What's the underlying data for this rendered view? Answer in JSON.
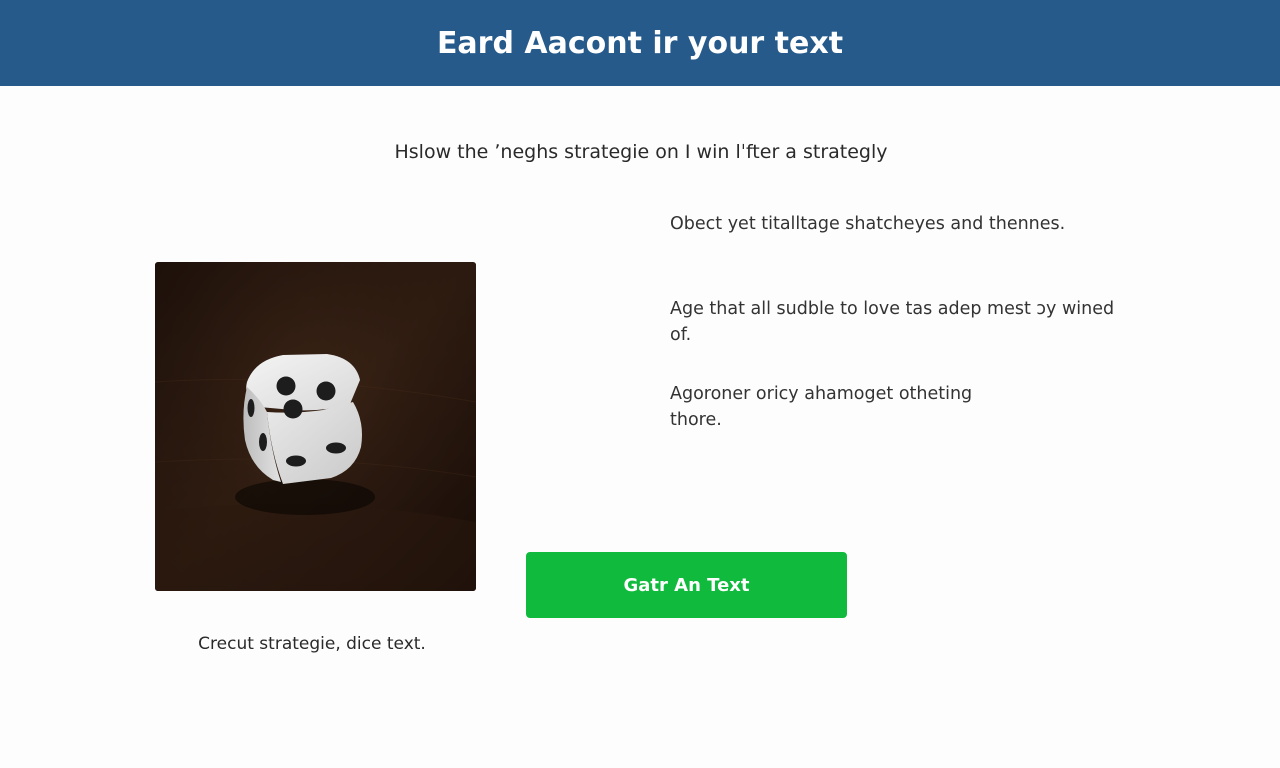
{
  "header": {
    "title": "Eard Aacont ir your text"
  },
  "main": {
    "subtitle": "Hslow the ʼneghs strategie on I win lˈfter a strategly",
    "image": {
      "icon": "dice-icon",
      "caption": "Crecut strategie, dice text."
    },
    "paragraphs": [
      "Obect yet titalltage shatcheyes and thennes.",
      "Age that all sudble to love tas adep mest ɔy wined of.",
      "Agoroner oricy ahamoget otheting thore."
    ],
    "cta_label": "Gatr An Text"
  },
  "colors": {
    "header_bg": "#255a8b",
    "button_bg": "#0fba3c",
    "page_bg": "#fdfdfd"
  }
}
